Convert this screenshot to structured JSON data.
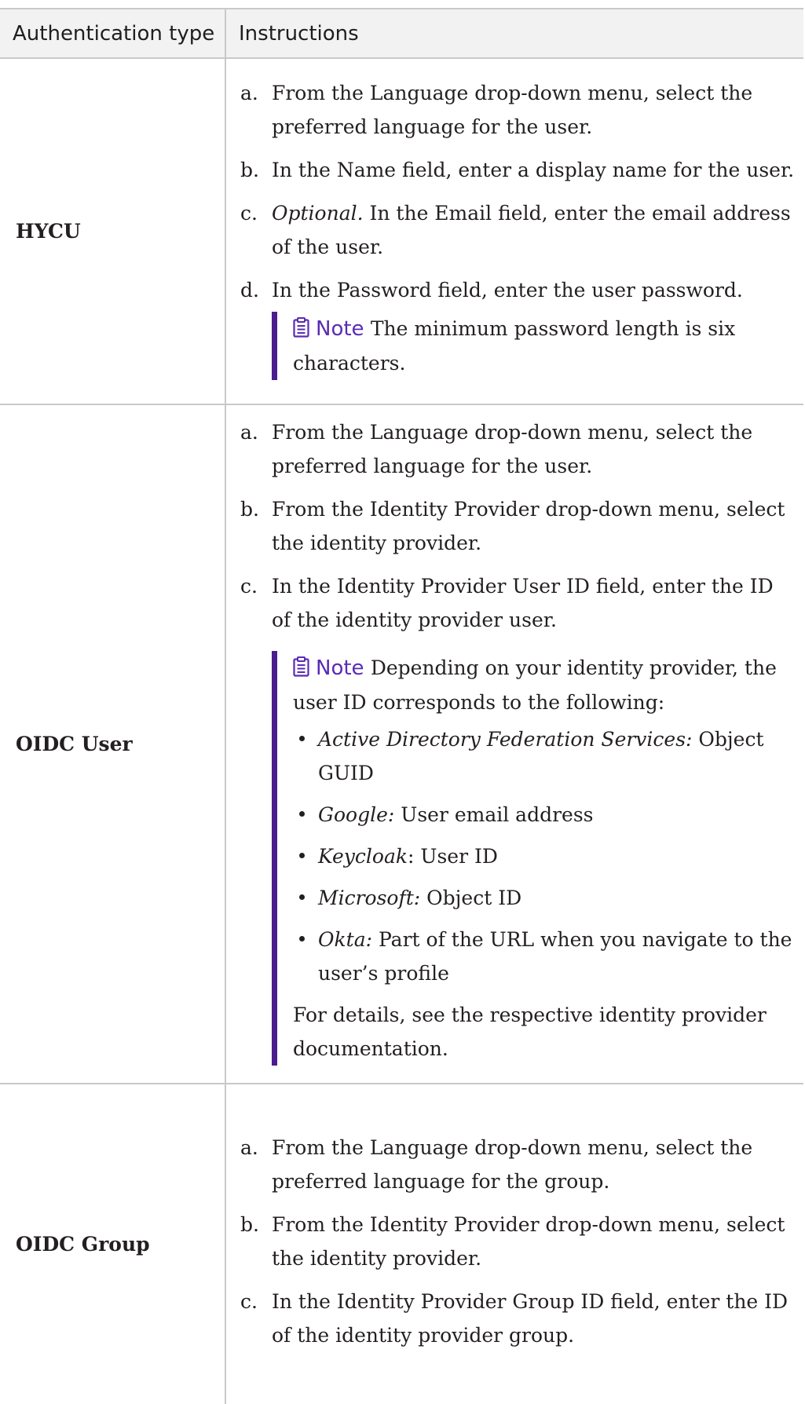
{
  "table": {
    "headers": [
      "Authentication type",
      "Instructions"
    ],
    "note_label": "Note",
    "rows": [
      {
        "type": "HYCU",
        "steps": [
          {
            "marker": "a.",
            "text": "From the Language drop-down menu, select the preferred language for the user."
          },
          {
            "marker": "b.",
            "text": "In the Name field, enter a display name for the user."
          },
          {
            "marker": "c.",
            "italic": "Optional.",
            "text": " In the Email field, enter the email address of the user."
          },
          {
            "marker": "d.",
            "text": "In the Password field, enter the user password."
          }
        ],
        "note": "The minimum password length is six characters."
      },
      {
        "type": "OIDC User",
        "steps": [
          {
            "marker": "a.",
            "text": "From the Language drop-down menu, select the preferred language for the user."
          },
          {
            "marker": "b.",
            "text": "From the Identity Provider drop-down menu, select the identity provider."
          },
          {
            "marker": "c.",
            "text": "In the Identity Provider User ID field, enter the ID of the identity provider user."
          }
        ],
        "note": "Depending on your identity provider, the user ID corresponds to the following:",
        "note_bullets": [
          {
            "italic": "Active Directory Federation Services:",
            "text": " Object GUID"
          },
          {
            "italic": "Google:",
            "text": " User email address"
          },
          {
            "italic": "Keycloak",
            "text": ": User ID"
          },
          {
            "italic": "Microsoft:",
            "text": " Object ID"
          },
          {
            "italic": "Okta:",
            "text": " Part of the URL when you navigate to the user’s profile"
          }
        ],
        "note_after": "For details, see the respective identity provider documentation."
      },
      {
        "type": "OIDC Group",
        "steps": [
          {
            "marker": "a.",
            "text": "From the Language drop-down menu, select the preferred language for the group."
          },
          {
            "marker": "b.",
            "text": "From the Identity Provider drop-down menu, select the identity provider."
          },
          {
            "marker": "c.",
            "text": "In the Identity Provider Group ID field, enter the ID of the identity provider group."
          }
        ]
      }
    ]
  },
  "colors": {
    "note_bar": "#4b1d8f",
    "note_label": "#5a2bb5",
    "header_bg": "#f2f2f2",
    "border": "#c9c9c9"
  },
  "icons": {
    "note": "clipboard-note-icon"
  }
}
